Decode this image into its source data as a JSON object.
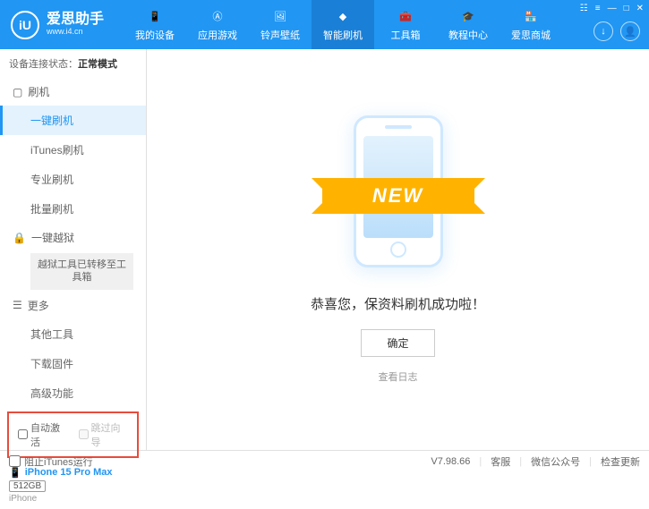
{
  "header": {
    "logo_letters": "iU",
    "app_name": "爱思助手",
    "site": "www.i4.cn",
    "navs": [
      {
        "label": "我的设备"
      },
      {
        "label": "应用游戏"
      },
      {
        "label": "铃声壁纸"
      },
      {
        "label": "智能刷机"
      },
      {
        "label": "工具箱"
      },
      {
        "label": "教程中心"
      },
      {
        "label": "爱思商城"
      }
    ],
    "win_controls": [
      "☷",
      "≡",
      "—",
      "□",
      "✕"
    ]
  },
  "sidebar": {
    "status_label": "设备连接状态：",
    "status_value": "正常模式",
    "group_flash": "刷机",
    "items_flash": [
      "一键刷机",
      "iTunes刷机",
      "专业刷机",
      "批量刷机"
    ],
    "group_jailbreak": "一键越狱",
    "jailbreak_notice": "越狱工具已转移至工具箱",
    "group_more": "更多",
    "items_more": [
      "其他工具",
      "下载固件",
      "高级功能"
    ],
    "check_auto": "自动激活",
    "check_skip": "跳过向导",
    "device": {
      "name": "iPhone 15 Pro Max",
      "storage": "512GB",
      "type": "iPhone"
    }
  },
  "main": {
    "ribbon": "NEW",
    "message": "恭喜您，保资料刷机成功啦！",
    "ok": "确定",
    "log": "查看日志"
  },
  "footer": {
    "block_itunes": "阻止iTunes运行",
    "version": "V7.98.66",
    "links": [
      "客服",
      "微信公众号",
      "检查更新"
    ]
  }
}
